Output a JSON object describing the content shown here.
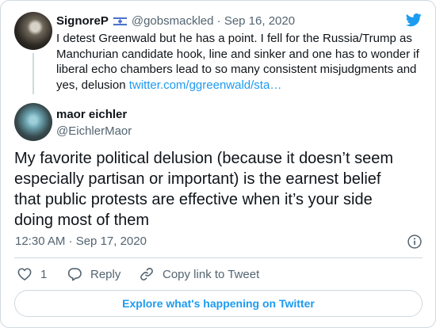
{
  "parent_tweet": {
    "display_name": "SignoreP",
    "flag": "israel-flag",
    "handle": "@gobsmackled",
    "separator": "·",
    "date": "Sep 16, 2020",
    "text": "I detest Greenwald but he has a point. I fell for the Russia/Trump as Manchurian candidate hook, line and sinker and one has to wonder if liberal echo chambers lead to so many consistent misjudgments and yes, delusion ",
    "link_text": "twitter.com/ggreenwald/sta…"
  },
  "main_tweet": {
    "display_name": "maor eichler",
    "handle": "@EichlerMaor",
    "text": "My favorite political delusion (because it doesn’t seem especially partisan or important) is the earnest belief that public protests are effective when it’s your side doing most of them",
    "timestamp": "12:30 AM · Sep 17, 2020"
  },
  "actions": {
    "like_count": "1",
    "reply_label": "Reply",
    "copy_link_label": "Copy link to Tweet"
  },
  "explore_button_label": "Explore what's happening on Twitter",
  "colors": {
    "accent": "#1d9bf0",
    "text": "#0f1419",
    "muted": "#536471",
    "border": "#cfd9de"
  }
}
